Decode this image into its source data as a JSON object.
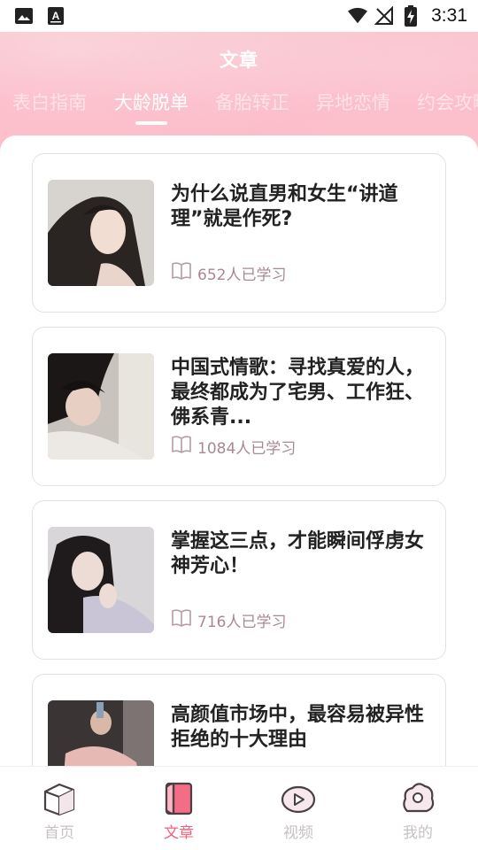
{
  "status_bar": {
    "time": "3:31",
    "left_icons": [
      "image-icon",
      "a-text-icon"
    ],
    "right_icons": [
      "wifi-icon",
      "no-signal-icon",
      "battery-charging-icon"
    ]
  },
  "header": {
    "title": "文章"
  },
  "tabs": [
    {
      "label": "表白指南",
      "active": false
    },
    {
      "label": "大龄脱单",
      "active": true
    },
    {
      "label": "备胎转正",
      "active": false
    },
    {
      "label": "异地恋情",
      "active": false
    },
    {
      "label": "约会攻略",
      "active": false
    }
  ],
  "articles": [
    {
      "title": "为什么说直男和女生“讲道理”就是作死?",
      "learners": "652人已学习"
    },
    {
      "title": "中国式情歌：寻找真爱的人，最终都成为了宅男、工作狂、佛系青...",
      "learners": "1084人已学习"
    },
    {
      "title": "掌握这三点，才能瞬间俘虏女神芳心！",
      "learners": "716人已学习"
    },
    {
      "title": "高颜值市场中，最容易被异性拒绝的十大理由",
      "learners": ""
    }
  ],
  "bottom_nav": [
    {
      "label": "首页",
      "icon": "home-cube-icon",
      "active": false
    },
    {
      "label": "文章",
      "icon": "article-book-icon",
      "active": true
    },
    {
      "label": "视频",
      "icon": "video-play-icon",
      "active": false
    },
    {
      "label": "我的",
      "icon": "profile-bubble-icon",
      "active": false
    }
  ],
  "colors": {
    "accent": "#f0607c",
    "header_pink": "#fbb6c4",
    "meta_text": "#a98991",
    "inactive_nav": "#c8c1c3"
  }
}
